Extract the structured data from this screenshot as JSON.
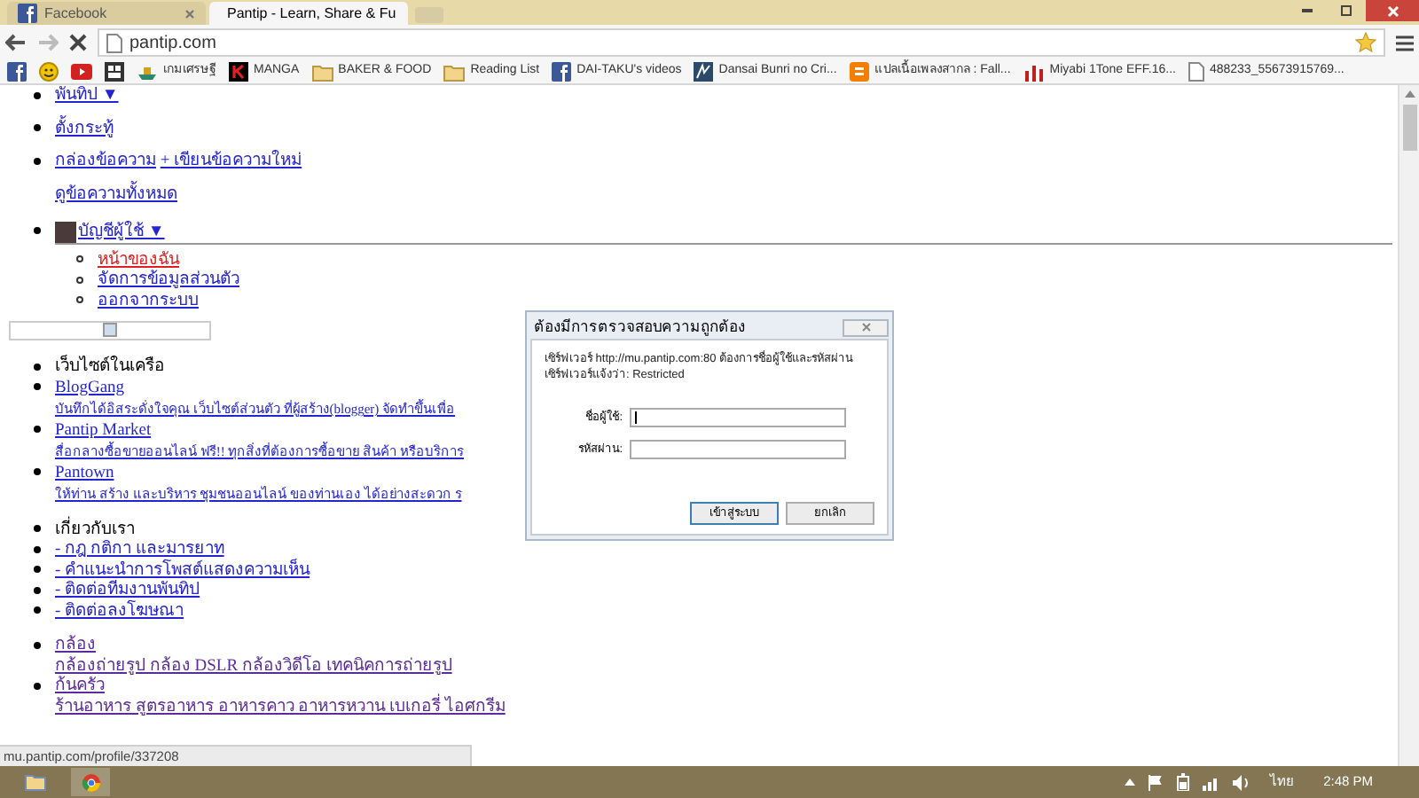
{
  "browser": {
    "tabs": [
      {
        "title": "Facebook",
        "kind": "facebook",
        "selected": false
      },
      {
        "title": "Pantip - Learn, Share & Fu",
        "kind": "loading",
        "selected": true
      }
    ],
    "url": "pantip.com",
    "bookmarks": [
      {
        "kind": "facebook"
      },
      {
        "kind": "smiley"
      },
      {
        "kind": "video"
      },
      {
        "kind": "game"
      },
      {
        "label": "เกมเศรษฐี",
        "kind": "ship"
      },
      {
        "label": "MANGA",
        "kind": "manga"
      },
      {
        "label": "BAKER & FOOD",
        "kind": "folder"
      },
      {
        "label": "Reading List",
        "kind": "folder"
      },
      {
        "label": "DAI-TAKU's videos",
        "kind": "facebook"
      },
      {
        "label": "Dansai Bunri no Cri...",
        "kind": "wave"
      },
      {
        "label": "แปลเนื้อเพลงสากล : Fall...",
        "kind": "blog"
      },
      {
        "label": "Miyabi 1Tone EFF.16...",
        "kind": "chart"
      },
      {
        "label": "488233_55673915769...",
        "kind": "page"
      }
    ]
  },
  "page": {
    "top_menu": [
      "พันทิป ▼",
      "ตั้งกระทู้"
    ],
    "messages": {
      "inbox": "กล่องข้อความ",
      "compose": "+ เขียนข้อความใหม่",
      "view_all": "ดูข้อความทั้งหมด"
    },
    "account": {
      "label": "บัญชีผู้ใช้ ▼",
      "items": [
        {
          "label": "หน้าของฉัน",
          "selected": true
        },
        {
          "label": "จัดการข้อมูลส่วนตัว",
          "selected": false
        },
        {
          "label": "ออกจากระบบ",
          "selected": false
        }
      ]
    },
    "network": {
      "heading": "เว็บไซต์ในเครือ",
      "sites": [
        {
          "name": "BlogGang",
          "description": "บันทึกได้อิสระดั่งใจคุณ เว็บไซต์ส่วนตัว ที่ผู้สร้าง(blogger) จัดทำขึ้นเพื่อ"
        },
        {
          "name": "Pantip Market",
          "description": "สื่อกลางซื้อขายออนไลน์ ฟรี!! ทุกสิ่งที่ต้องการซื้อขาย สินค้า หรือบริการ"
        },
        {
          "name": "Pantown",
          "description": "ให้ท่าน สร้าง และบริหาร ชุมชนออนไลน์ ของท่านเอง ได้อย่างสะดวก ร"
        }
      ]
    },
    "about": {
      "heading": "เกี่ยวกับเรา",
      "links": [
        "- กฎ กติกา และมารยาท",
        "- คำแนะนำการโพสต์แสดงความเห็น",
        "- ติดต่อทีมงานพันทิป",
        "- ติดต่อลงโฆษณา"
      ]
    },
    "categories": [
      {
        "name": "กล้อง",
        "description": "กล้องถ่ายรูป กล้อง DSLR กล้องวิดีโอ เทคนิคการถ่ายรูป"
      },
      {
        "name": "ก้นครัว",
        "description": "ร้านอาหาร สูตรอาหาร อาหารคาว อาหารหวาน เบเกอรี่ ไอศกรีม"
      }
    ]
  },
  "dialog": {
    "title": "ต้องมีการตรวจสอบความถูกต้อง",
    "message": "เซิร์ฟเวอร์ http://mu.pantip.com:80 ต้องการชื่อผู้ใช้และรหัสผ่าน เซิร์ฟเวอร์แจ้งว่า: Restricted",
    "username_label": "ชื่อผู้ใช้:",
    "password_label": "รหัสผ่าน:",
    "buttons": [
      "เข้าสู่ระบบ",
      "ยกเลิก"
    ]
  },
  "status_bar": "mu.pantip.com/profile/337208",
  "taskbar": {
    "language": "ไทย",
    "clock": "2:48 PM"
  }
}
